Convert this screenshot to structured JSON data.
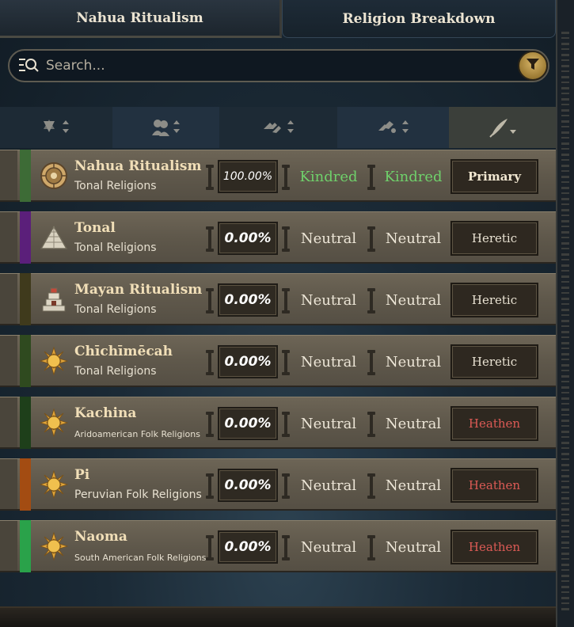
{
  "tabs": [
    {
      "label": "Nahua Ritualism"
    },
    {
      "label": "Religion Breakdown"
    }
  ],
  "search": {
    "placeholder": "Search..."
  },
  "colors": {
    "kindred": "#6fd16b",
    "heathen": "#dc5a55",
    "row_bg": "#5f584b"
  },
  "sort_columns": [
    {
      "icon": "faith-sort-icon",
      "direction": "up-down"
    },
    {
      "icon": "people-sort-icon",
      "direction": "up-down"
    },
    {
      "icon": "opinion-a-sort-icon",
      "direction": "up-down"
    },
    {
      "icon": "opinion-b-sort-icon",
      "direction": "up-down"
    },
    {
      "icon": "quill-sort-icon",
      "direction": "down",
      "active": true
    }
  ],
  "rows": [
    {
      "name": "Nahua Ritualism",
      "group": "Tonal Religions",
      "percent": "100.00%",
      "opinion1": "Kindred",
      "opinion2": "Kindred",
      "status": "Primary",
      "ribbon_color": "#3d6b36",
      "icon": "nahua-emblem-icon"
    },
    {
      "name": "Tonal",
      "group": "Tonal Religions",
      "percent": "0.00%",
      "opinion1": "Neutral",
      "opinion2": "Neutral",
      "status": "Heretic",
      "ribbon_color": "#5b1f7a",
      "icon": "pyramid-icon"
    },
    {
      "name": "Mayan Ritualism",
      "group": "Tonal Religions",
      "percent": "0.00%",
      "opinion1": "Neutral",
      "opinion2": "Neutral",
      "status": "Heretic",
      "ribbon_color": "#3f3a1c",
      "icon": "temple-icon"
    },
    {
      "name": "Chīchīmēcah",
      "group": "Tonal Religions",
      "percent": "0.00%",
      "opinion1": "Neutral",
      "opinion2": "Neutral",
      "status": "Heretic",
      "ribbon_color": "#2f4a1f",
      "icon": "sun-icon"
    },
    {
      "name": "Kachina",
      "group": "Aridoamerican Folk Religions",
      "percent": "0.00%",
      "opinion1": "Neutral",
      "opinion2": "Neutral",
      "status": "Heathen",
      "ribbon_color": "#1e3f1a",
      "icon": "sun-icon"
    },
    {
      "name": "Pi",
      "group": "Peruvian Folk Religions",
      "percent": "0.00%",
      "opinion1": "Neutral",
      "opinion2": "Neutral",
      "status": "Heathen",
      "ribbon_color": "#a34c12",
      "icon": "sun-icon"
    },
    {
      "name": "Naoma",
      "group": "South American Folk Religions",
      "percent": "0.00%",
      "opinion1": "Neutral",
      "opinion2": "Neutral",
      "status": "Heathen",
      "ribbon_color": "#2aa24a",
      "icon": "sun-icon"
    }
  ]
}
